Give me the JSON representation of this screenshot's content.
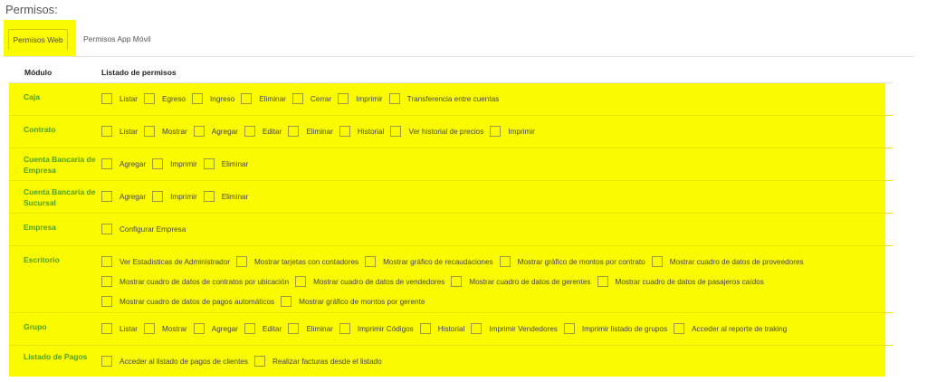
{
  "section_title": "Permisos:",
  "tabs": [
    {
      "label": "Permisos Web",
      "active": true
    },
    {
      "label": "Permisos App Móvil",
      "active": false
    }
  ],
  "table": {
    "col_module": "Módulo",
    "col_permissions": "Listado de permisos"
  },
  "colors": {
    "highlight": "#fbfb00",
    "module_text": "#4d9f1c"
  },
  "modules": [
    {
      "name": "Caja",
      "lines": [
        [
          "Listar",
          "Egreso",
          "Ingreso",
          "Eliminar",
          "Cerrar",
          "Imprimir",
          "Transferencia entre cuentas"
        ]
      ]
    },
    {
      "name": "Contrato",
      "lines": [
        [
          "Listar",
          "Mostrar",
          "Agregar",
          "Editar",
          "Eliminar",
          "Historial",
          "Ver historial de precios",
          "Imprimir"
        ]
      ]
    },
    {
      "name": "Cuenta Bancaria de Empresa",
      "lines": [
        [
          "Agregar",
          "Imprimir",
          "Eliminar"
        ]
      ]
    },
    {
      "name": "Cuenta Bancaria de Sucursal",
      "lines": [
        [
          "Agregar",
          "Imprimir",
          "Eliminar"
        ]
      ]
    },
    {
      "name": "Empresa",
      "lines": [
        [
          "Configurar Empresa"
        ]
      ]
    },
    {
      "name": "Escritorio",
      "lines": [
        [
          "Ver Estadisticas de Administrador",
          "Mostrar tarjetas con contadores",
          "Mostrar gráfico de recaudaciones",
          "Mostrar gráfico de montos por contrato",
          "Mostrar cuadro de datos de proveedores"
        ],
        [
          "Mostrar cuadro de datos de contratos por ubicación",
          "Mostrar cuadro de datos de vendedores",
          "Mostrar cuadro de datos de gerentes",
          "Mostrar cuadro de datos de pasajeros caídos"
        ],
        [
          "Mostrar cuadro de datos de pagos automáticos",
          "Mostrar gráfico de montos por gerente"
        ]
      ]
    },
    {
      "name": "Grupo",
      "lines": [
        [
          "Listar",
          "Mostrar",
          "Agregar",
          "Editar",
          "Eliminar",
          "Imprimir Códigos",
          "Historial",
          "Imprimir Vendedores",
          "Imprimir listado de grupos",
          "Acceder al reporte de traking"
        ]
      ]
    },
    {
      "name": "Listado de Pagos",
      "lines": [
        [
          "Acceder al listado de pagos de clientes",
          "Realizar facturas desde el listado"
        ]
      ]
    }
  ]
}
